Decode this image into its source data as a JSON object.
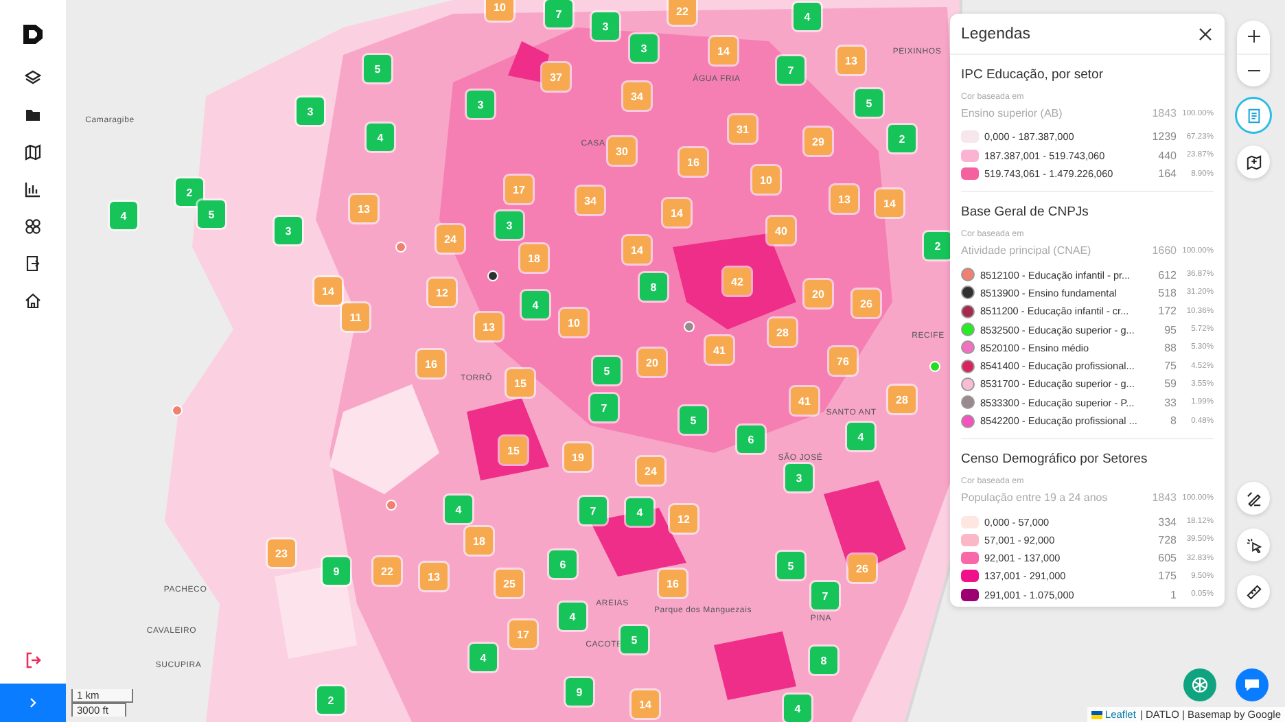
{
  "sidebar": {
    "items": [
      {
        "kind": "layers",
        "selected": false
      },
      {
        "kind": "folder",
        "selected": false
      },
      {
        "kind": "map",
        "selected": false
      },
      {
        "kind": "chart",
        "selected": false
      },
      {
        "kind": "grid",
        "selected": false
      },
      {
        "kind": "exit-box",
        "selected": false
      },
      {
        "kind": "home",
        "selected": false
      }
    ]
  },
  "map": {
    "place_labels": [
      "PEIXINHOS",
      "ÁGUA FRIA",
      "Camaragibe",
      "CASA",
      "RECIFE",
      "TORRÕ",
      "SANTO ANT",
      "SÃO JOSÉ",
      "PACHECO",
      "AREIAS",
      "Parque dos Manguezais",
      "PINA",
      "CAVALEIRO",
      "CACOTE",
      "SUCUPIRA"
    ],
    "clusters": [
      {
        "count": "10",
        "kind": "orange"
      },
      {
        "count": "7",
        "kind": "green"
      },
      {
        "count": "22",
        "kind": "orange"
      },
      {
        "count": "4",
        "kind": "green"
      },
      {
        "count": "3",
        "kind": "green"
      },
      {
        "count": "3",
        "kind": "green"
      },
      {
        "count": "14",
        "kind": "orange"
      },
      {
        "count": "13",
        "kind": "orange"
      },
      {
        "count": "5",
        "kind": "green"
      },
      {
        "count": "37",
        "kind": "orange"
      },
      {
        "count": "7",
        "kind": "green"
      },
      {
        "count": "3",
        "kind": "green"
      },
      {
        "count": "3",
        "kind": "green"
      },
      {
        "count": "34",
        "kind": "orange"
      },
      {
        "count": "5",
        "kind": "green"
      },
      {
        "count": "4",
        "kind": "green"
      },
      {
        "count": "31",
        "kind": "orange"
      },
      {
        "count": "29",
        "kind": "orange"
      },
      {
        "count": "2",
        "kind": "green"
      },
      {
        "count": "30",
        "kind": "orange"
      },
      {
        "count": "16",
        "kind": "orange"
      },
      {
        "count": "2",
        "kind": "green"
      },
      {
        "count": "17",
        "kind": "orange"
      },
      {
        "count": "10",
        "kind": "orange"
      },
      {
        "count": "4",
        "kind": "green"
      },
      {
        "count": "5",
        "kind": "green"
      },
      {
        "count": "13",
        "kind": "orange"
      },
      {
        "count": "34",
        "kind": "orange"
      },
      {
        "count": "14",
        "kind": "orange"
      },
      {
        "count": "13",
        "kind": "orange"
      },
      {
        "count": "14",
        "kind": "orange"
      },
      {
        "count": "3",
        "kind": "green"
      },
      {
        "count": "24",
        "kind": "orange"
      },
      {
        "count": "3",
        "kind": "green"
      },
      {
        "count": "18",
        "kind": "orange"
      },
      {
        "count": "14",
        "kind": "orange"
      },
      {
        "count": "40",
        "kind": "orange"
      },
      {
        "count": "2",
        "kind": "green"
      },
      {
        "count": "14",
        "kind": "orange"
      },
      {
        "count": "12",
        "kind": "orange"
      },
      {
        "count": "8",
        "kind": "green"
      },
      {
        "count": "42",
        "kind": "orange"
      },
      {
        "count": "20",
        "kind": "orange"
      },
      {
        "count": "4",
        "kind": "green"
      },
      {
        "count": "26",
        "kind": "orange"
      },
      {
        "count": "11",
        "kind": "orange"
      },
      {
        "count": "13",
        "kind": "orange"
      },
      {
        "count": "10",
        "kind": "orange"
      },
      {
        "count": "28",
        "kind": "orange"
      },
      {
        "count": "41",
        "kind": "orange"
      },
      {
        "count": "16",
        "kind": "orange"
      },
      {
        "count": "5",
        "kind": "green"
      },
      {
        "count": "20",
        "kind": "orange"
      },
      {
        "count": "76",
        "kind": "orange"
      },
      {
        "count": "15",
        "kind": "orange"
      },
      {
        "count": "7",
        "kind": "green"
      },
      {
        "count": "41",
        "kind": "orange"
      },
      {
        "count": "28",
        "kind": "orange"
      },
      {
        "count": "5",
        "kind": "green"
      },
      {
        "count": "6",
        "kind": "green"
      },
      {
        "count": "4",
        "kind": "green"
      },
      {
        "count": "15",
        "kind": "orange"
      },
      {
        "count": "19",
        "kind": "orange"
      },
      {
        "count": "24",
        "kind": "orange"
      },
      {
        "count": "3",
        "kind": "green"
      },
      {
        "count": "4",
        "kind": "green"
      },
      {
        "count": "7",
        "kind": "green"
      },
      {
        "count": "4",
        "kind": "green"
      },
      {
        "count": "12",
        "kind": "orange"
      },
      {
        "count": "23",
        "kind": "orange"
      },
      {
        "count": "18",
        "kind": "orange"
      },
      {
        "count": "9",
        "kind": "green"
      },
      {
        "count": "22",
        "kind": "orange"
      },
      {
        "count": "13",
        "kind": "orange"
      },
      {
        "count": "25",
        "kind": "orange"
      },
      {
        "count": "6",
        "kind": "green"
      },
      {
        "count": "16",
        "kind": "orange"
      },
      {
        "count": "5",
        "kind": "green"
      },
      {
        "count": "26",
        "kind": "orange"
      },
      {
        "count": "7",
        "kind": "green"
      },
      {
        "count": "4",
        "kind": "green"
      },
      {
        "count": "17",
        "kind": "orange"
      },
      {
        "count": "5",
        "kind": "green"
      },
      {
        "count": "4",
        "kind": "green"
      },
      {
        "count": "8",
        "kind": "green"
      },
      {
        "count": "2",
        "kind": "green"
      },
      {
        "count": "9",
        "kind": "green"
      },
      {
        "count": "14",
        "kind": "orange"
      },
      {
        "count": "4",
        "kind": "green"
      }
    ],
    "points": [
      {
        "color": "#f08070"
      },
      {
        "color": "#2f3130"
      },
      {
        "color": "#9a8a8e"
      },
      {
        "color": "#22dd22"
      },
      {
        "color": "#f08070"
      },
      {
        "color": "#f08070"
      }
    ],
    "scale": {
      "metric": "1 km",
      "imperial": "3000 ft"
    },
    "attribution": {
      "link": "Leaflet",
      "rest": "| DATLO | Basemap by Google"
    }
  },
  "legend": {
    "title": "Legendas",
    "sections": [
      {
        "title": "IPC Educação, por setor",
        "basis_label": "Cor baseada em",
        "basis": "Ensino superior (AB)",
        "total": "1843",
        "total_pct": "100.00%",
        "items": [
          {
            "kind": "box",
            "label": "0,000 - 187.387,000",
            "count": "1239",
            "pct": "67.23%",
            "color": "#f6e7ec"
          },
          {
            "kind": "box",
            "label": "187.387,001 - 519.743,060",
            "count": "440",
            "pct": "23.87%",
            "color": "#fbb3d3"
          },
          {
            "kind": "box",
            "label": "519.743,061 - 1.479.226,060",
            "count": "164",
            "pct": "8.90%",
            "color": "#f5609e"
          }
        ]
      },
      {
        "title": "Base Geral de CNPJs",
        "basis_label": "Cor baseada em",
        "basis": "Atividade principal (CNAE)",
        "total": "1660",
        "total_pct": "100.00%",
        "items": [
          {
            "kind": "dot",
            "label": "8512100 - Educação infantil - pr...",
            "count": "612",
            "pct": "36.87%",
            "color": "#f08070"
          },
          {
            "kind": "dot",
            "label": "8513900 - Ensino fundamental",
            "count": "518",
            "pct": "31.20%",
            "color": "#2f3130"
          },
          {
            "kind": "dot",
            "label": "8511200 - Educação infantil - cr...",
            "count": "172",
            "pct": "10.36%",
            "color": "#a8294e"
          },
          {
            "kind": "dot",
            "label": "8532500 - Educação superior - g...",
            "count": "95",
            "pct": "5.72%",
            "color": "#22ee22"
          },
          {
            "kind": "dot",
            "label": "8520100 - Ensino médio",
            "count": "88",
            "pct": "5.30%",
            "color": "#f46fc0"
          },
          {
            "kind": "dot",
            "label": "8541400 - Educação profissional...",
            "count": "75",
            "pct": "4.52%",
            "color": "#d8245e"
          },
          {
            "kind": "dot",
            "label": "8531700 - Educação superior - g...",
            "count": "59",
            "pct": "3.55%",
            "color": "#f8bcd4"
          },
          {
            "kind": "dot",
            "label": "8533300 - Educação superior - P...",
            "count": "33",
            "pct": "1.99%",
            "color": "#9a8a8e"
          },
          {
            "kind": "dot",
            "label": "8542200 - Educação profissional ...",
            "count": "8",
            "pct": "0.48%",
            "color": "#f552c0"
          }
        ]
      },
      {
        "title": "Censo Demográfico por Setores",
        "basis_label": "Cor baseada em",
        "basis": "População entre 19 a 24 anos",
        "total": "1843",
        "total_pct": "100.00%",
        "items": [
          {
            "kind": "box",
            "label": "0,000 - 57,000",
            "count": "334",
            "pct": "18.12%",
            "color": "#fde7e0"
          },
          {
            "kind": "box",
            "label": "57,001 - 92,000",
            "count": "728",
            "pct": "39.50%",
            "color": "#fbb7c6"
          },
          {
            "kind": "box",
            "label": "92,001 - 137,000",
            "count": "605",
            "pct": "32.83%",
            "color": "#f868a8"
          },
          {
            "kind": "box",
            "label": "137,001 - 291,000",
            "count": "175",
            "pct": "9.50%",
            "color": "#f0108a"
          },
          {
            "kind": "box",
            "label": "291,001 - 1.075,000",
            "count": "1",
            "pct": "0.05%",
            "color": "#9c0071"
          }
        ]
      }
    ]
  },
  "controls": {
    "upper": [
      {
        "kind": "legend",
        "selected": true
      },
      {
        "kind": "map-frame",
        "selected": false
      }
    ],
    "lower": [
      {
        "kind": "draw"
      },
      {
        "kind": "select"
      },
      {
        "kind": "ruler"
      }
    ]
  }
}
